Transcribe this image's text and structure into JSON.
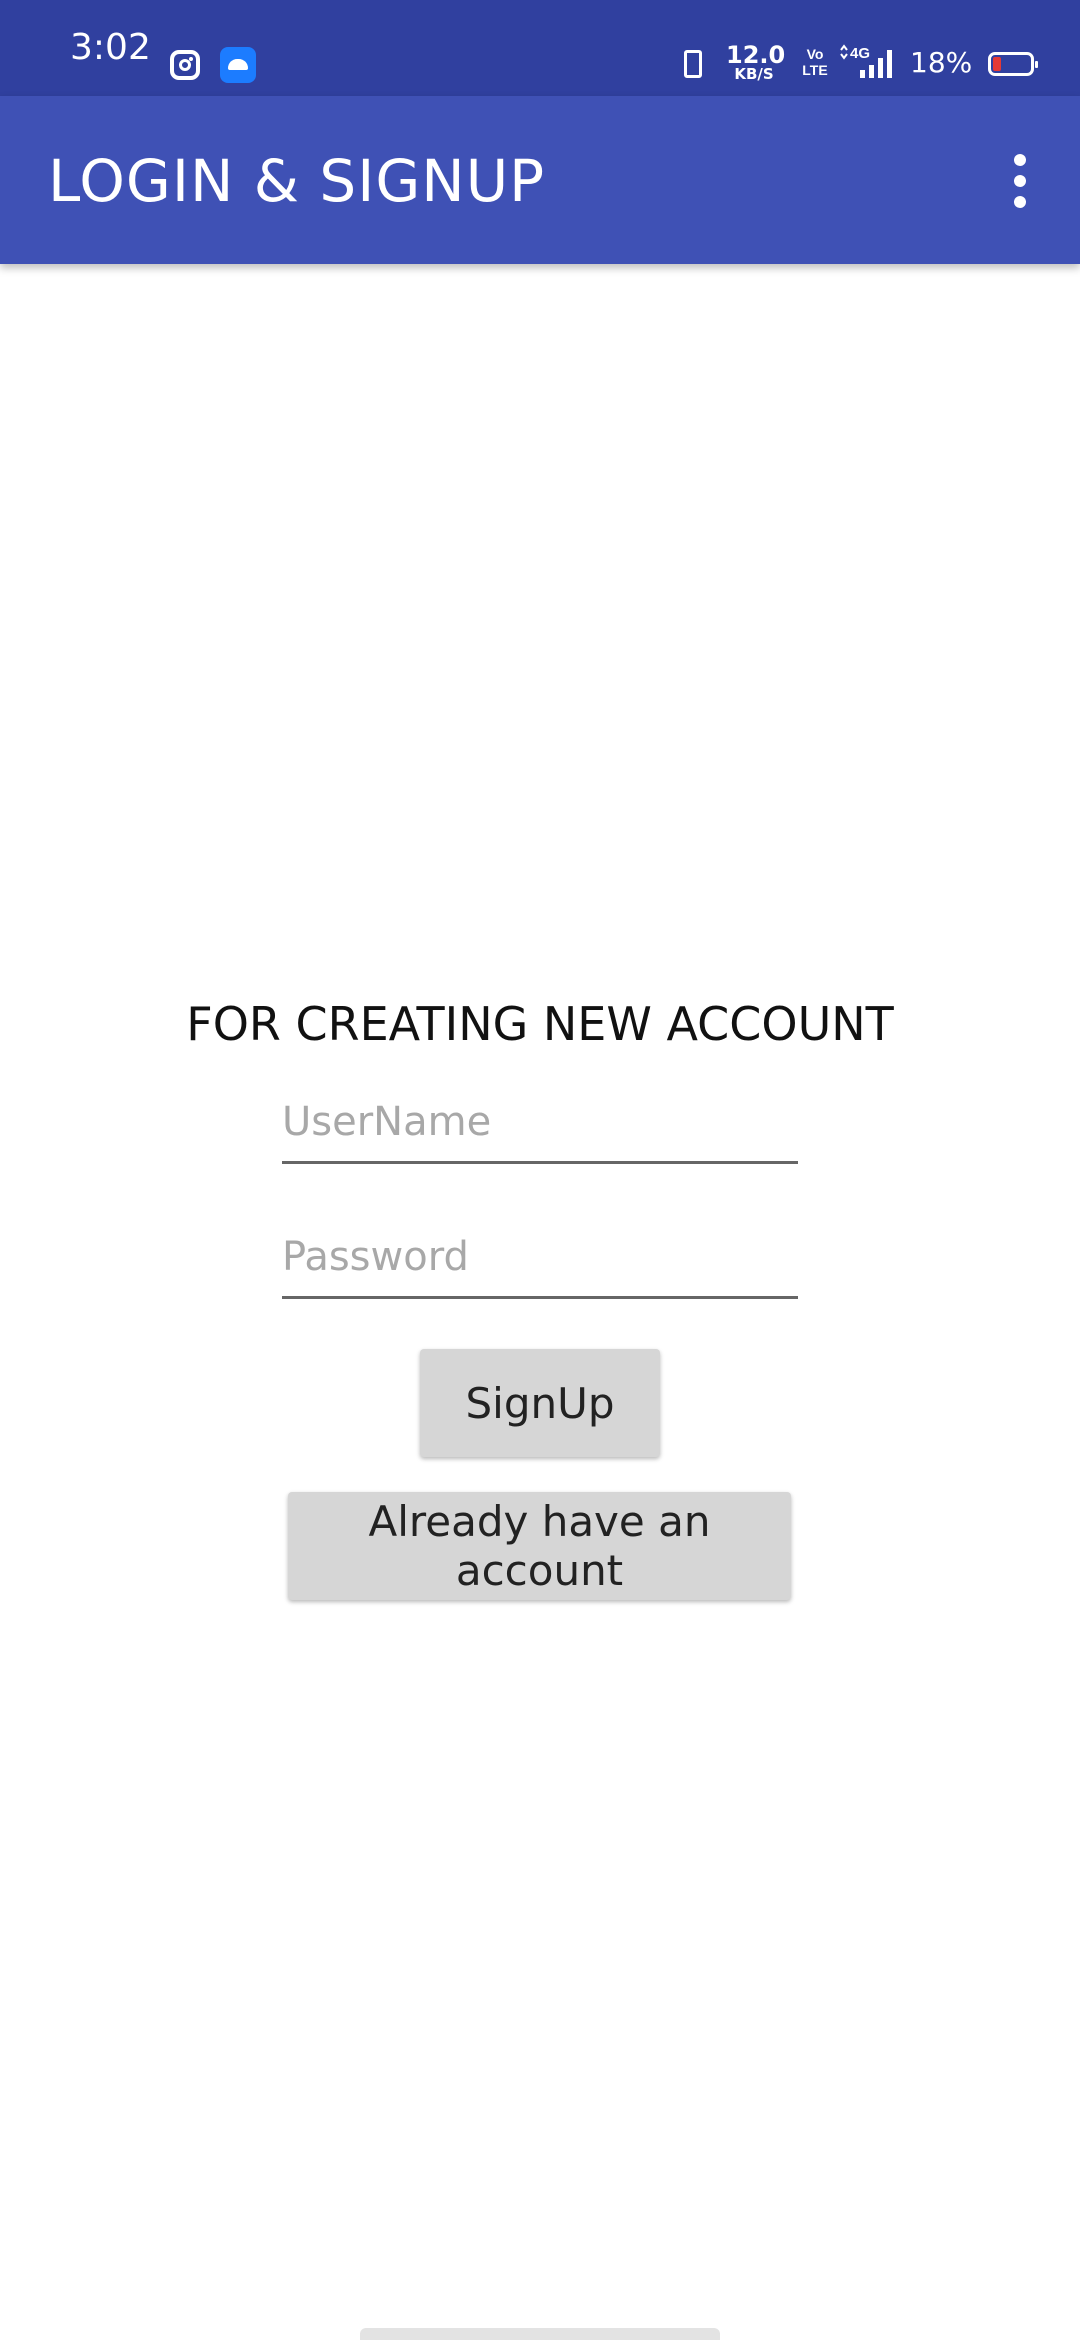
{
  "status_bar": {
    "time": "3:02",
    "icons": [
      "instagram-icon",
      "android-icon"
    ],
    "net_speed_value": "12.0",
    "net_speed_unit": "KB/S",
    "volte_top": "Vo",
    "volte_bottom": "LTE",
    "network": "4G",
    "battery_percent": "18%"
  },
  "app_bar": {
    "title": "LOGIN & SIGNUP",
    "menu_icon": "more-vert-icon"
  },
  "form": {
    "heading": "FOR CREATING NEW ACCOUNT",
    "username_placeholder": "UserName",
    "username_value": "",
    "password_placeholder": "Password",
    "password_value": "",
    "signup_label": "SignUp",
    "existing_account_label": "Already have an account"
  },
  "colors": {
    "status_bar": "#30409f",
    "app_bar": "#3f51b5",
    "button": "#d6d6d6"
  }
}
